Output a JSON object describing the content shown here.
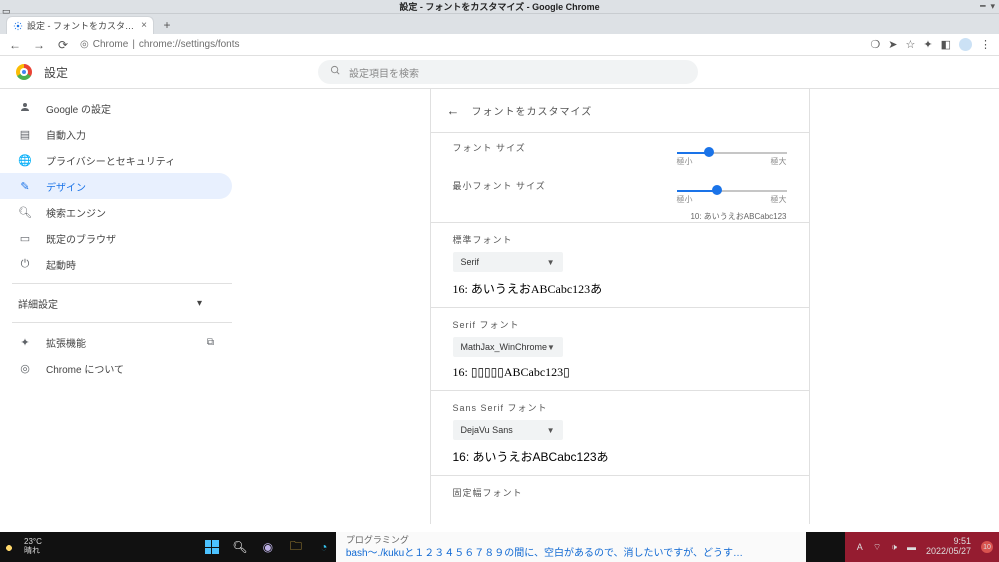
{
  "window": {
    "title": "設定 - フォントをカスタマイズ - Google Chrome"
  },
  "tab": {
    "title": "設定 - フォントをカスタマイズ"
  },
  "addressbar": {
    "scheme_label": "Chrome",
    "url": "chrome://settings/fonts"
  },
  "header": {
    "app_title": "設定",
    "search_placeholder": "設定項目を検索"
  },
  "sidebar": {
    "items": [
      {
        "icon": "person",
        "label": "Google の設定"
      },
      {
        "icon": "autofill",
        "label": "自動入力"
      },
      {
        "icon": "globe",
        "label": "プライバシーとセキュリティ"
      },
      {
        "icon": "brush",
        "label": "デザイン"
      },
      {
        "icon": "search",
        "label": "検索エンジン"
      },
      {
        "icon": "browser",
        "label": "既定のブラウザ"
      },
      {
        "icon": "power",
        "label": "起動時"
      }
    ],
    "advanced_label": "詳細設定",
    "ext_label": "拡張機能",
    "about_label": "Chrome について"
  },
  "page": {
    "back_title": "フォントをカスタマイズ",
    "font_size_label": "フォント サイズ",
    "min_font_label": "最小フォント サイズ",
    "slider_min": "極小",
    "slider_max": "極大",
    "min_sample": "10: あいうえおABCabc123",
    "sections": {
      "standard": {
        "label": "標準フォント",
        "value": "Serif",
        "sample": "16: あいうえおABCabc123あ"
      },
      "serif": {
        "label": "Serif フォント",
        "value": "MathJax_WinChrome",
        "sample": "16: ▯▯▯▯▯ABCabc123▯"
      },
      "sans": {
        "label": "Sans Serif フォント",
        "value": "DejaVu Sans",
        "sample": "16: あいうえおABCabc123あ"
      },
      "fixed": {
        "label": "固定幅フォント"
      }
    }
  },
  "taskbar": {
    "weather_temp": "23°C",
    "weather_cond": "晴れ",
    "search_tag": "プログラミング",
    "search_link": "bash〜./kukuと１２３４５６７８９の間に、空白があるので、消したいですが、どうす…",
    "ime": "A",
    "time": "9:51",
    "date": "2022/05/27",
    "notif": "10"
  }
}
